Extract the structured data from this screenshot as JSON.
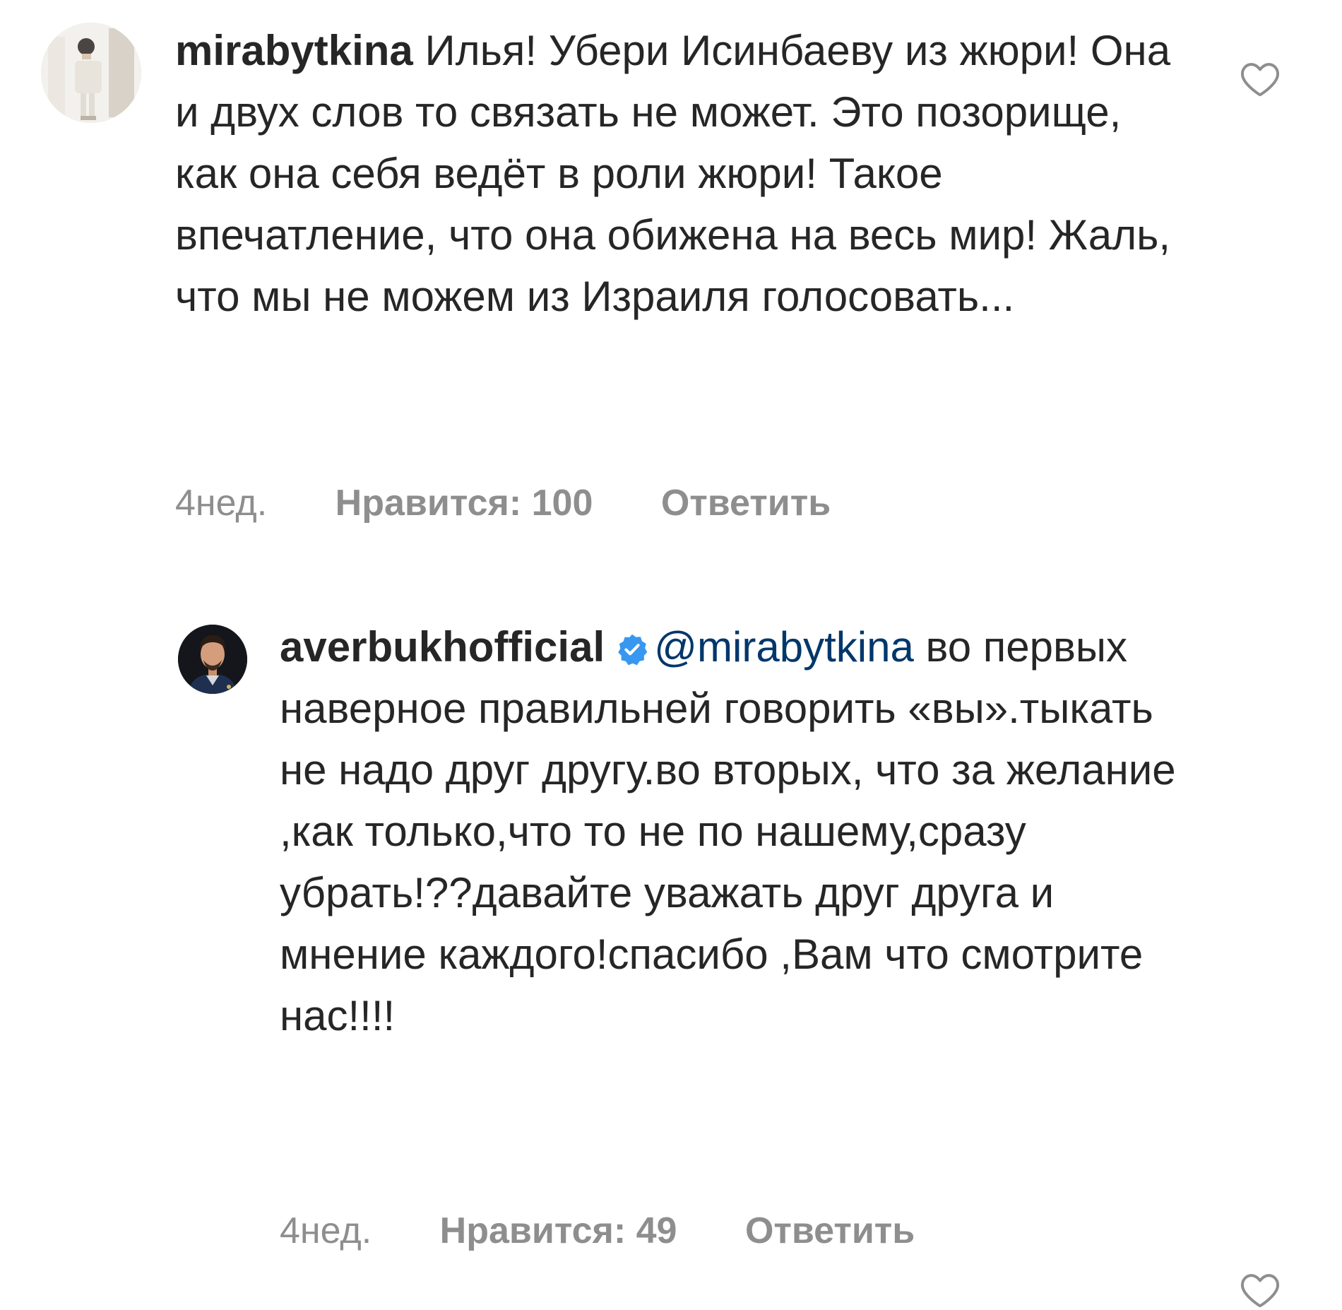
{
  "comments": [
    {
      "username": "mirabytkina",
      "text": " Илья! Убери Исинбаеву из жюри! Она и двух слов то связать не может. Это позорище, как она себя ведёт в роли жюри! Такое впечатление, что она обижена на весь мир! Жаль, что мы не можем из Израиля голосовать...",
      "time": "4нед.",
      "likes": "Нравится: 100",
      "reply": "Ответить",
      "avatar": "user-photo-avatar",
      "like_icon": "heart-outline-icon"
    },
    {
      "username": "averbukhofficial",
      "verified_icon": "verified-badge-icon",
      "mention": "@mirabytkina",
      "text": " во первых наверное правильней говорить «вы».тыкать не надо друг другу.во вторых, что за желание ,как только,что то не по нашему,сразу убрать!??давайте уважать друг друга и мнение каждого!спасибо ,Вам что смотрите нас!!!!",
      "time": "4нед.",
      "likes": "Нравится: 49",
      "reply": "Ответить",
      "avatar": "user-photo-avatar",
      "like_icon": "heart-outline-icon"
    }
  ],
  "colors": {
    "text": "#262626",
    "secondary": "#8e8e8e",
    "mention": "#00376b",
    "verified": "#3897f0",
    "background": "#ffffff"
  }
}
